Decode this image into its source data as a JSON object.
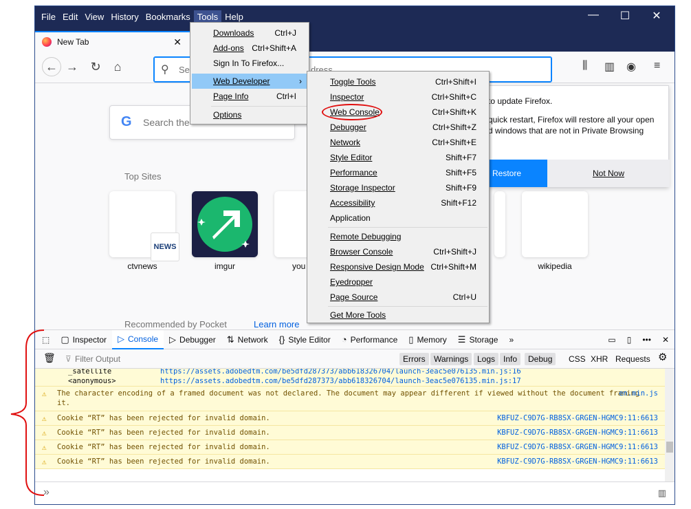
{
  "menubar": [
    "File",
    "Edit",
    "View",
    "History",
    "Bookmarks",
    "Tools",
    "Help"
  ],
  "window_controls": {
    "minimize": "—",
    "maximize": "☐",
    "close": "✕"
  },
  "tab": {
    "title": "New Tab",
    "close": "✕"
  },
  "urlbar": {
    "placeholder_left": "Se",
    "placeholder_right": "dress"
  },
  "content": {
    "search_placeholder": "Search the",
    "top_sites_title": "Top Sites",
    "tiles": [
      "ctvnews",
      "imgur",
      "you",
      "wikipedia"
    ],
    "news_badge": "NEWS",
    "pocket_title": "Recommended by Pocket",
    "learn_more": "Learn more"
  },
  "notification": {
    "line1": "to update Firefox.",
    "line2": "quick restart, Firefox will restore all your open",
    "line3": "d windows that are not in Private Browsing",
    "restore": "Restore",
    "not_now": "Not Now"
  },
  "tools_menu": [
    {
      "label": "Downloads",
      "shortcut": "Ctrl+J"
    },
    {
      "label": "Add-ons",
      "shortcut": "Ctrl+Shift+A"
    },
    {
      "label": "Sign In To Firefox...",
      "shortcut": ""
    },
    {
      "label": "Web Developer",
      "shortcut": ""
    },
    {
      "label": "Page Info",
      "shortcut": "Ctrl+I"
    },
    {
      "label": "Options",
      "shortcut": ""
    }
  ],
  "webdev_menu": [
    {
      "label": "Toggle Tools",
      "shortcut": "Ctrl+Shift+I"
    },
    {
      "label": "Inspector",
      "shortcut": "Ctrl+Shift+C"
    },
    {
      "label": "Web Console",
      "shortcut": "Ctrl+Shift+K"
    },
    {
      "label": "Debugger",
      "shortcut": "Ctrl+Shift+Z"
    },
    {
      "label": "Network",
      "shortcut": "Ctrl+Shift+E"
    },
    {
      "label": "Style Editor",
      "shortcut": "Shift+F7"
    },
    {
      "label": "Performance",
      "shortcut": "Shift+F5"
    },
    {
      "label": "Storage Inspector",
      "shortcut": "Shift+F9"
    },
    {
      "label": "Accessibility",
      "shortcut": "Shift+F12"
    },
    {
      "label": "Application",
      "shortcut": ""
    },
    {
      "label": "Remote Debugging",
      "shortcut": ""
    },
    {
      "label": "Browser Console",
      "shortcut": "Ctrl+Shift+J"
    },
    {
      "label": "Responsive Design Mode",
      "shortcut": "Ctrl+Shift+M"
    },
    {
      "label": "Eyedropper",
      "shortcut": ""
    },
    {
      "label": "Page Source",
      "shortcut": "Ctrl+U"
    },
    {
      "label": "Get More Tools",
      "shortcut": ""
    }
  ],
  "devtools": {
    "tabs": [
      "Inspector",
      "Console",
      "Debugger",
      "Network",
      "Style Editor",
      "Performance",
      "Memory",
      "Storage"
    ],
    "filter_placeholder": "Filter Output",
    "filters": [
      "Errors",
      "Warnings",
      "Logs",
      "Info",
      "Debug"
    ],
    "filters_plain": [
      "CSS",
      "XHR",
      "Requests"
    ],
    "stack": [
      {
        "fn": "_satellite",
        "src": "https://assets.adobedtm.com/be5dfd287373/abb618326704/launch-3eac5e076135.min.js:16"
      },
      {
        "fn": "<anonymous>",
        "src": "https://assets.adobedtm.com/be5dfd287373/abb618326704/launch-3eac5e076135.min.js:17"
      }
    ],
    "messages": [
      {
        "text": "The character encoding of a framed document was not declared. The document may appear different if viewed without the document framing",
        "text2": "it.",
        "src": "en.min.js"
      },
      {
        "text": "Cookie “RT” has been rejected for invalid domain.",
        "src": "KBFUZ-C9D7G-RB8SX-GRGEN-HGMC9:11:6613"
      },
      {
        "text": "Cookie “RT” has been rejected for invalid domain.",
        "src": "KBFUZ-C9D7G-RB8SX-GRGEN-HGMC9:11:6613"
      },
      {
        "text": "Cookie “RT” has been rejected for invalid domain.",
        "src": "KBFUZ-C9D7G-RB8SX-GRGEN-HGMC9:11:6613"
      },
      {
        "text": "Cookie “RT” has been rejected for invalid domain.",
        "src": "KBFUZ-C9D7G-RB8SX-GRGEN-HGMC9:11:6613"
      }
    ],
    "prompt": "»"
  }
}
